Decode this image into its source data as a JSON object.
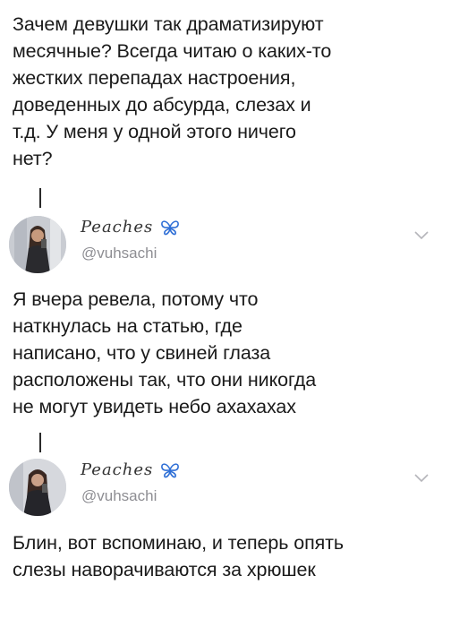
{
  "tweets": [
    {
      "text": "Зачем девушки так драматизируют\nмесячные? Всегда читаю о каких-то\nжестких перепадах настроения,\nдоведенных до абсурда, слезах и\nт.д. У меня у одной этого ничего\nнет?"
    },
    {
      "display_name": "Peaches",
      "handle": "@vuhsachi",
      "text": "Я вчера ревела, потому что\nнаткнулась на статью, где\nнаписано, что у свиней глаза\nрасположены так, что они никогда\nне могут увидеть небо ахахахах"
    },
    {
      "display_name": "Peaches",
      "handle": "@vuhsachi",
      "text": "Блин, вот вспоминаю, и теперь опять\nслезы наворачиваются за хрюшек"
    }
  ],
  "icons": {
    "emoji": "butterfly-icon",
    "menu": "chevron-down-icon"
  },
  "colors": {
    "text": "#1a1a1a",
    "handle": "#8e8e93",
    "butterfly": "#2f6fd6"
  }
}
